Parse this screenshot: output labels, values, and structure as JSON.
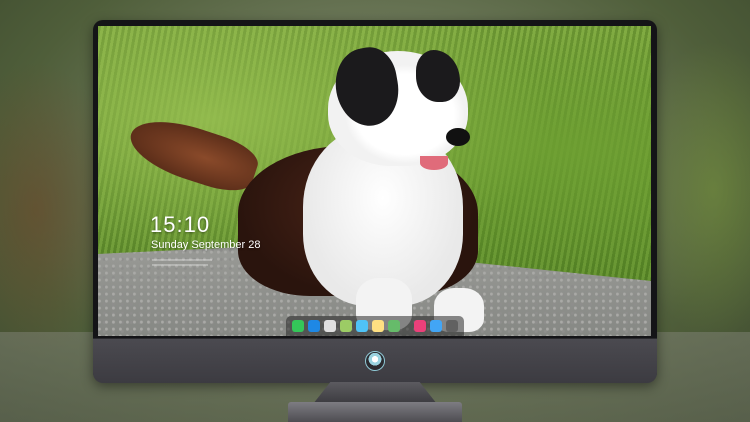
{
  "lock_screen": {
    "time": "15:10",
    "date": "Sunday September 28",
    "notice_lines": [
      "xxxxxxxxxxxxxxxxxxxxxxxxxxxxxx",
      "xxxxxxxxxxxxxxxxxxxxxxxxxxxx"
    ]
  },
  "dock": {
    "items": [
      {
        "name": "messages-icon",
        "glyph": "",
        "color": "#34c759"
      },
      {
        "name": "files-icon",
        "glyph": "",
        "color": "#1e88e5"
      },
      {
        "name": "clock-icon",
        "glyph": "",
        "color": "#e0e0e0"
      },
      {
        "name": "maps-icon",
        "glyph": "",
        "color": "#9ccc65"
      },
      {
        "name": "video-icon",
        "glyph": "",
        "color": "#4fc3f7"
      },
      {
        "name": "notes-icon",
        "glyph": "",
        "color": "#ffe082"
      },
      {
        "name": "photos-icon",
        "glyph": "",
        "color": "#66bb6a"
      },
      {
        "name": "music-icon",
        "glyph": "",
        "color": "#ec407a"
      },
      {
        "name": "app-store-icon",
        "glyph": "",
        "color": "#42a5f5"
      },
      {
        "name": "camera-icon",
        "glyph": "",
        "color": "#616161"
      }
    ]
  },
  "colors": {
    "bezel": "#141417",
    "chin": "#45444a",
    "accent": "#9ad3e0"
  }
}
